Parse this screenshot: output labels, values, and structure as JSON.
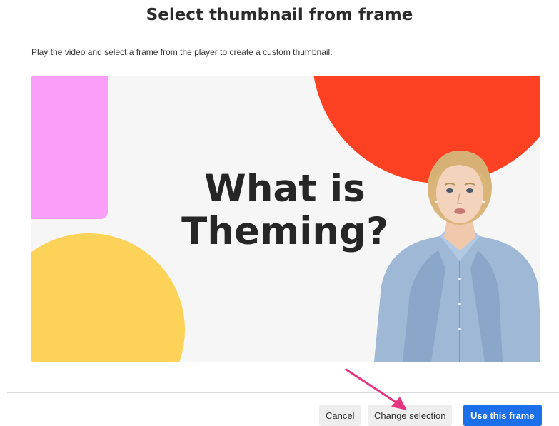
{
  "dialog": {
    "title": "Select thumbnail from frame",
    "description": "Play the video and select a frame from the player to create a custom thumbnail."
  },
  "player": {
    "video_title_line1": "What is",
    "video_title_line2": "Theming?",
    "colors": {
      "background": "#f7f6f7",
      "pink_shape": "#f99ef9",
      "red_shape": "#fd4122",
      "yellow_shape": "#fcd358"
    }
  },
  "footer": {
    "cancel_label": "Cancel",
    "change_selection_label": "Change selection",
    "use_frame_label": "Use this frame",
    "primary_color": "#1b6fe8"
  },
  "annotation": {
    "arrow_color": "#e6357f"
  }
}
